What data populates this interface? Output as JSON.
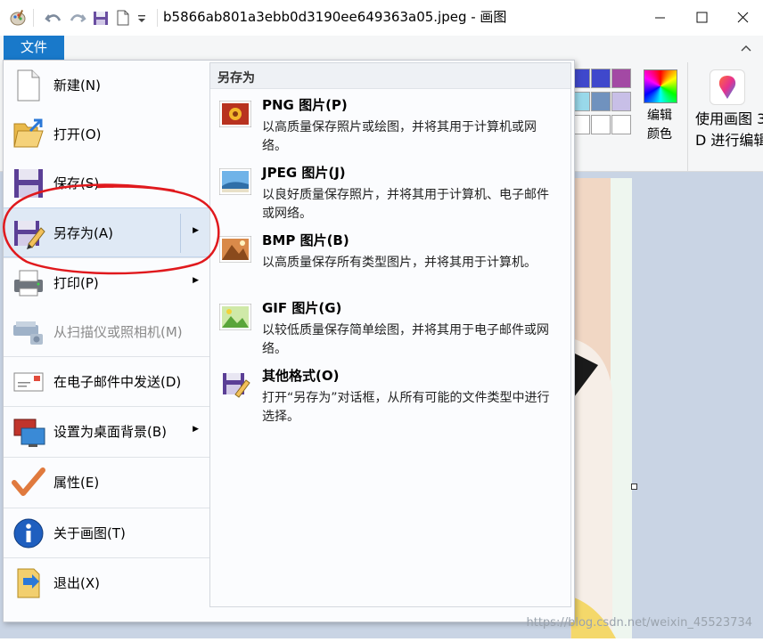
{
  "window": {
    "title": "b5866ab801a3ebb0d3190ee649363a05.jpeg - 画图",
    "minimize_glyph": "—",
    "maximize_glyph": "☐",
    "close_glyph": "✕"
  },
  "ribbon": {
    "file_tab_label": "文件",
    "edit_colors_line1": "编辑",
    "edit_colors_line2": "颜色",
    "paint3d_line1": "使用画图 3",
    "paint3d_line2": "D 进行编辑",
    "palette_colors": [
      "#3f48cc",
      "#3f48cc",
      "#a349a4",
      "#99d9ea",
      "#7092be",
      "#c8bfe7",
      "#ffffff",
      "#ffffff",
      "#ffffff"
    ]
  },
  "file_menu": {
    "items": [
      {
        "label": "新建(N)",
        "icon": "new-document-icon",
        "has_submenu": false,
        "enabled": true
      },
      {
        "label": "打开(O)",
        "icon": "open-folder-icon",
        "has_submenu": false,
        "enabled": true
      },
      {
        "label": "保存(S)",
        "icon": "save-disk-icon",
        "has_submenu": false,
        "enabled": true
      },
      {
        "label": "另存为(A)",
        "icon": "save-as-icon",
        "has_submenu": true,
        "enabled": true
      },
      {
        "label": "打印(P)",
        "icon": "printer-icon",
        "has_submenu": true,
        "enabled": true
      },
      {
        "label": "从扫描仪或照相机(M)",
        "icon": "scanner-icon",
        "has_submenu": false,
        "enabled": false
      },
      {
        "label": "在电子邮件中发送(D)",
        "icon": "email-icon",
        "has_submenu": false,
        "enabled": true
      },
      {
        "label": "设置为桌面背景(B)",
        "icon": "desktop-background-icon",
        "has_submenu": true,
        "enabled": true
      },
      {
        "label": "属性(E)",
        "icon": "properties-check-icon",
        "has_submenu": false,
        "enabled": true
      },
      {
        "label": "关于画图(T)",
        "icon": "info-icon",
        "has_submenu": false,
        "enabled": true
      },
      {
        "label": "退出(X)",
        "icon": "exit-icon",
        "has_submenu": false,
        "enabled": true
      }
    ],
    "submenu": {
      "title": "另存为",
      "formats": [
        {
          "title": "PNG 图片(P)",
          "desc": "以高质量保存照片或绘图，并将其用于计算机或网络。",
          "icon": "png-image-icon"
        },
        {
          "title": "JPEG 图片(J)",
          "desc": "以良好质量保存照片，并将其用于计算机、电子邮件或网络。",
          "icon": "jpeg-image-icon"
        },
        {
          "title": "BMP 图片(B)",
          "desc": "以高质量保存所有类型图片，并将其用于计算机。",
          "icon": "bmp-image-icon"
        },
        {
          "title": "GIF 图片(G)",
          "desc": "以较低质量保存简单绘图，并将其用于电子邮件或网络。",
          "icon": "gif-image-icon"
        },
        {
          "title": "其他格式(O)",
          "desc": "打开“另存为”对话框，从所有可能的文件类型中进行选择。",
          "icon": "other-formats-icon"
        }
      ]
    }
  },
  "annotation_color": "#e0191d",
  "watermark": "https://blog.csdn.net/weixin_45523734"
}
